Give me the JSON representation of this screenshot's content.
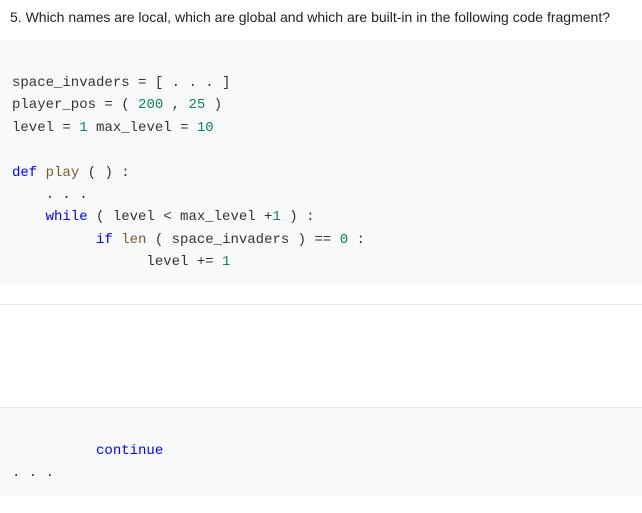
{
  "question": "5. Which names are local, which are global and which are built-in in the following code fragment?",
  "code": {
    "l1": {
      "a": "space_invaders ",
      "b": "=",
      "c": " [ . . . ]"
    },
    "l2": {
      "a": "player_pos ",
      "b": "=",
      "c": " ( ",
      "d": "200",
      "e": " , ",
      "f": "25",
      "g": " )"
    },
    "l3": {
      "a": "level ",
      "b": "=",
      "c": " ",
      "d": "1",
      "e": " max_level ",
      "f": "=",
      "g": " ",
      "h": "10"
    },
    "l4": "",
    "l5": {
      "a": "def",
      "b": " ",
      "c": "play",
      "d": " ( ) :"
    },
    "l6": "    . . .",
    "l7": {
      "a": "    ",
      "b": "while",
      "c": " ( level < max_level +",
      "d": "1",
      "e": " ) :"
    },
    "l8": {
      "a": "          ",
      "b": "if",
      "c": " ",
      "d": "len",
      "e": " ( space_invaders ) == ",
      "f": "0",
      "g": " :"
    },
    "l9": {
      "a": "                level += ",
      "b": "1"
    }
  },
  "bottom": {
    "l1": {
      "a": "          ",
      "b": "continue"
    },
    "l2": ". . ."
  }
}
